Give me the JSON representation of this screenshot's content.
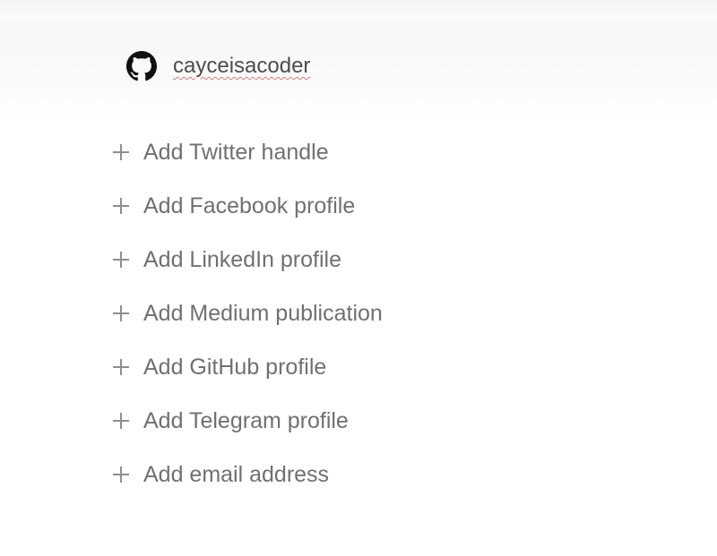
{
  "account": {
    "icon": "github-icon",
    "username": "cayceisacoder"
  },
  "social_links": [
    {
      "label": "Add Twitter handle",
      "icon": "plus-icon"
    },
    {
      "label": "Add Facebook profile",
      "icon": "plus-icon"
    },
    {
      "label": "Add LinkedIn profile",
      "icon": "plus-icon"
    },
    {
      "label": "Add Medium publication",
      "icon": "plus-icon"
    },
    {
      "label": "Add GitHub profile",
      "icon": "plus-icon"
    },
    {
      "label": "Add Telegram profile",
      "icon": "plus-icon"
    },
    {
      "label": "Add email address",
      "icon": "plus-icon"
    }
  ],
  "colors": {
    "text": "#707070",
    "account_text": "#4d4d4d",
    "spellcheck_underline": "#e07a7a",
    "hero_background": "#f7f7f7"
  }
}
